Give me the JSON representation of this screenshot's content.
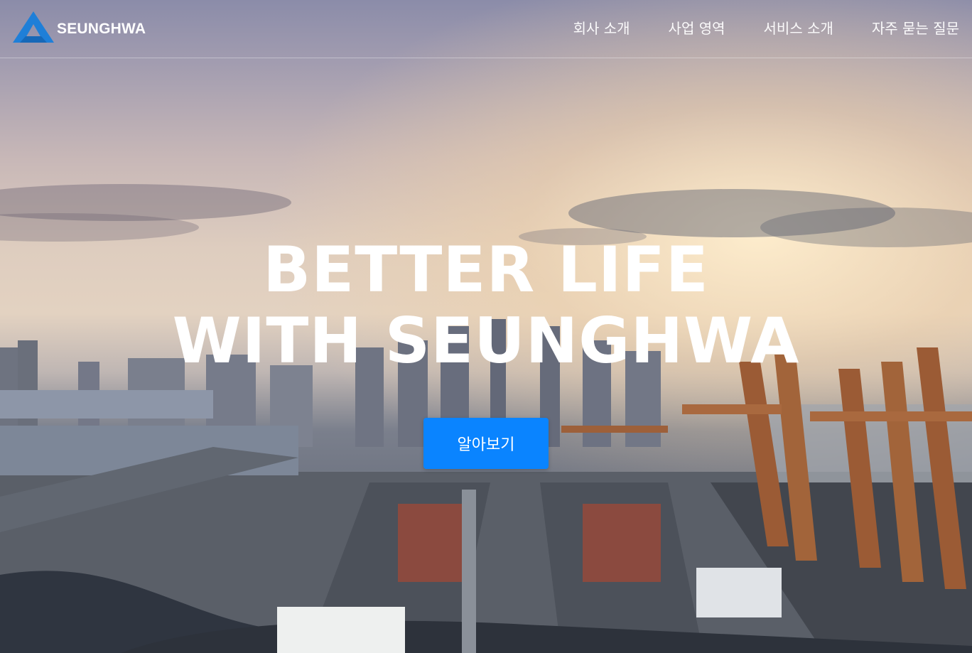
{
  "brand": {
    "name": "SEUNGHWA",
    "logo_icon": "triangle-a-logo-icon",
    "logo_color": "#1f7fd8"
  },
  "nav": {
    "items": [
      {
        "label": "회사 소개"
      },
      {
        "label": "사업 영역"
      },
      {
        "label": "서비스 소개"
      },
      {
        "label": "자주 묻는 질문"
      }
    ]
  },
  "hero": {
    "title": "BETTER LIFE WITH SEUNGHWA",
    "cta_label": "알아보기",
    "cta_color": "#0a84ff"
  }
}
